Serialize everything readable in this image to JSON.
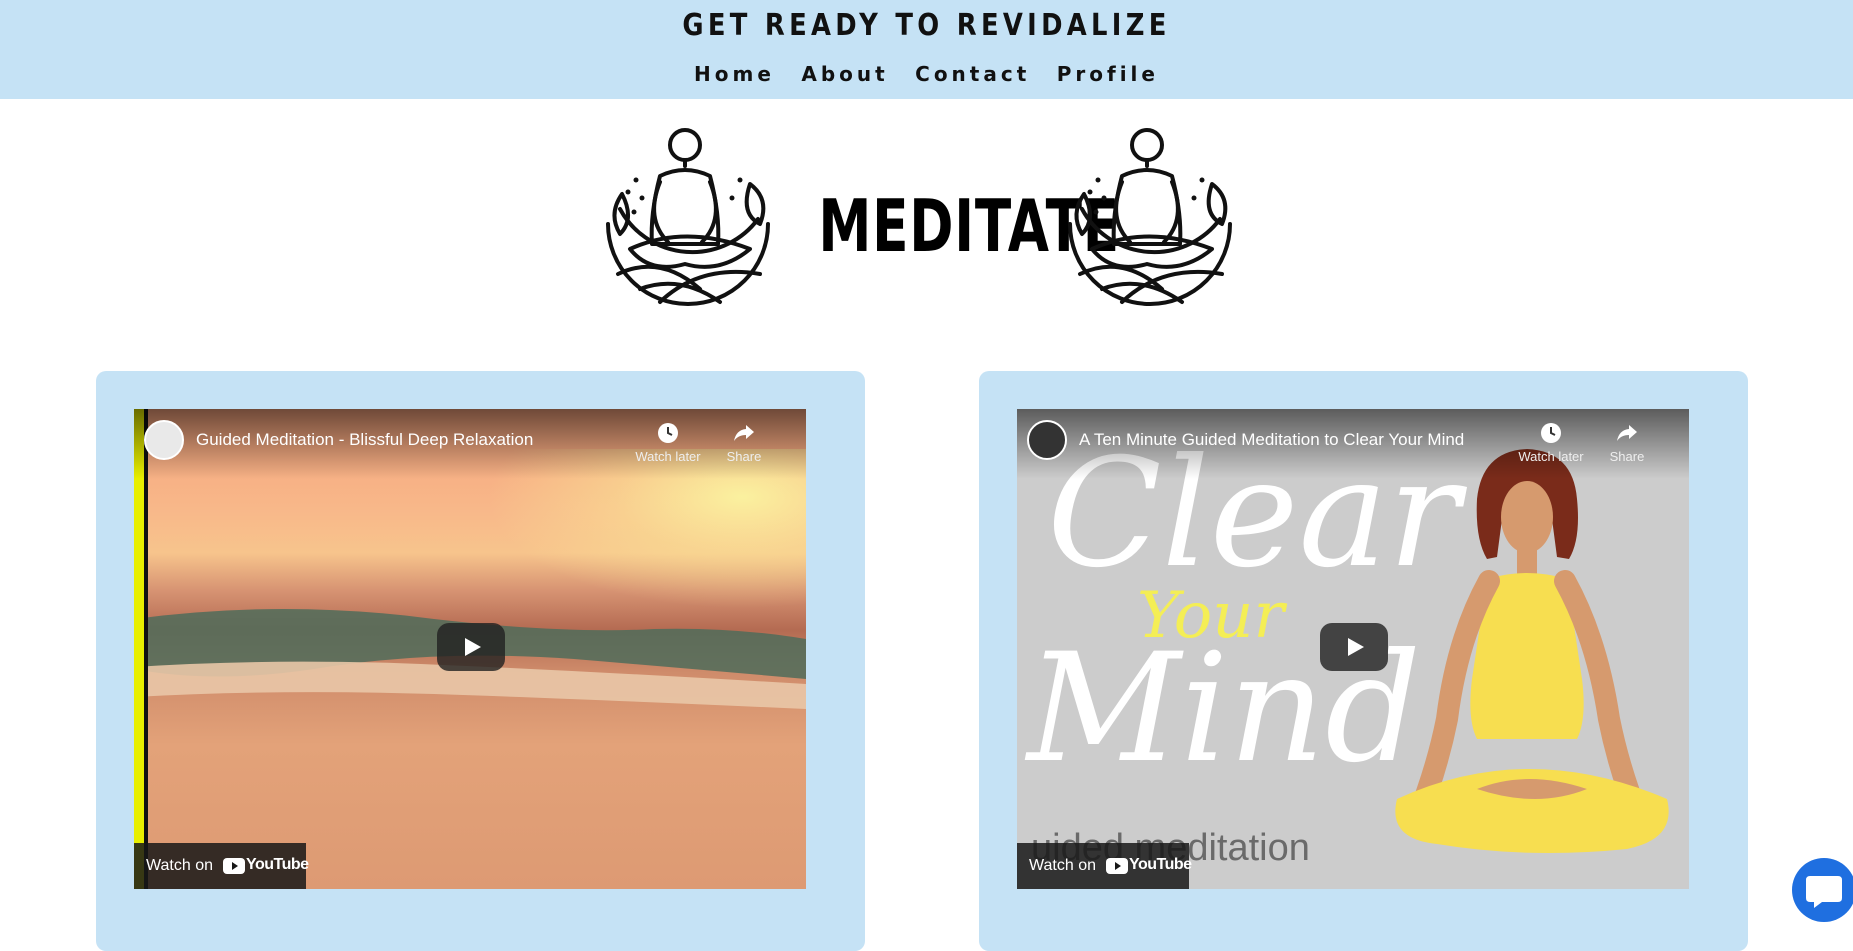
{
  "header": {
    "title": "GET READY TO REVIDALIZE",
    "nav": [
      "Home",
      "About",
      "Contact",
      "Profile"
    ],
    "background": "#c5e2f5"
  },
  "banner": {
    "word": "MEDITATE",
    "icon": "meditating-person-icon"
  },
  "videos": [
    {
      "title": "Guided Meditation - Blissful Deep Relaxation",
      "watch_later": "Watch later",
      "share": "Share",
      "watch_on": "Watch on",
      "brand": "YouTube"
    },
    {
      "title": "A Ten Minute Guided Meditation to Clear Your Mind",
      "watch_later": "Watch later",
      "share": "Share",
      "watch_on": "Watch on",
      "brand": "YouTube",
      "thumb_text": {
        "line1": "Clear",
        "line2": "Your",
        "line3": "Mind",
        "line4": "uided meditation"
      }
    }
  ],
  "colors": {
    "card": "#c5e2f5",
    "chat_button": "#1f6fe0"
  },
  "chat": {
    "icon": "chat-bubble-icon"
  }
}
